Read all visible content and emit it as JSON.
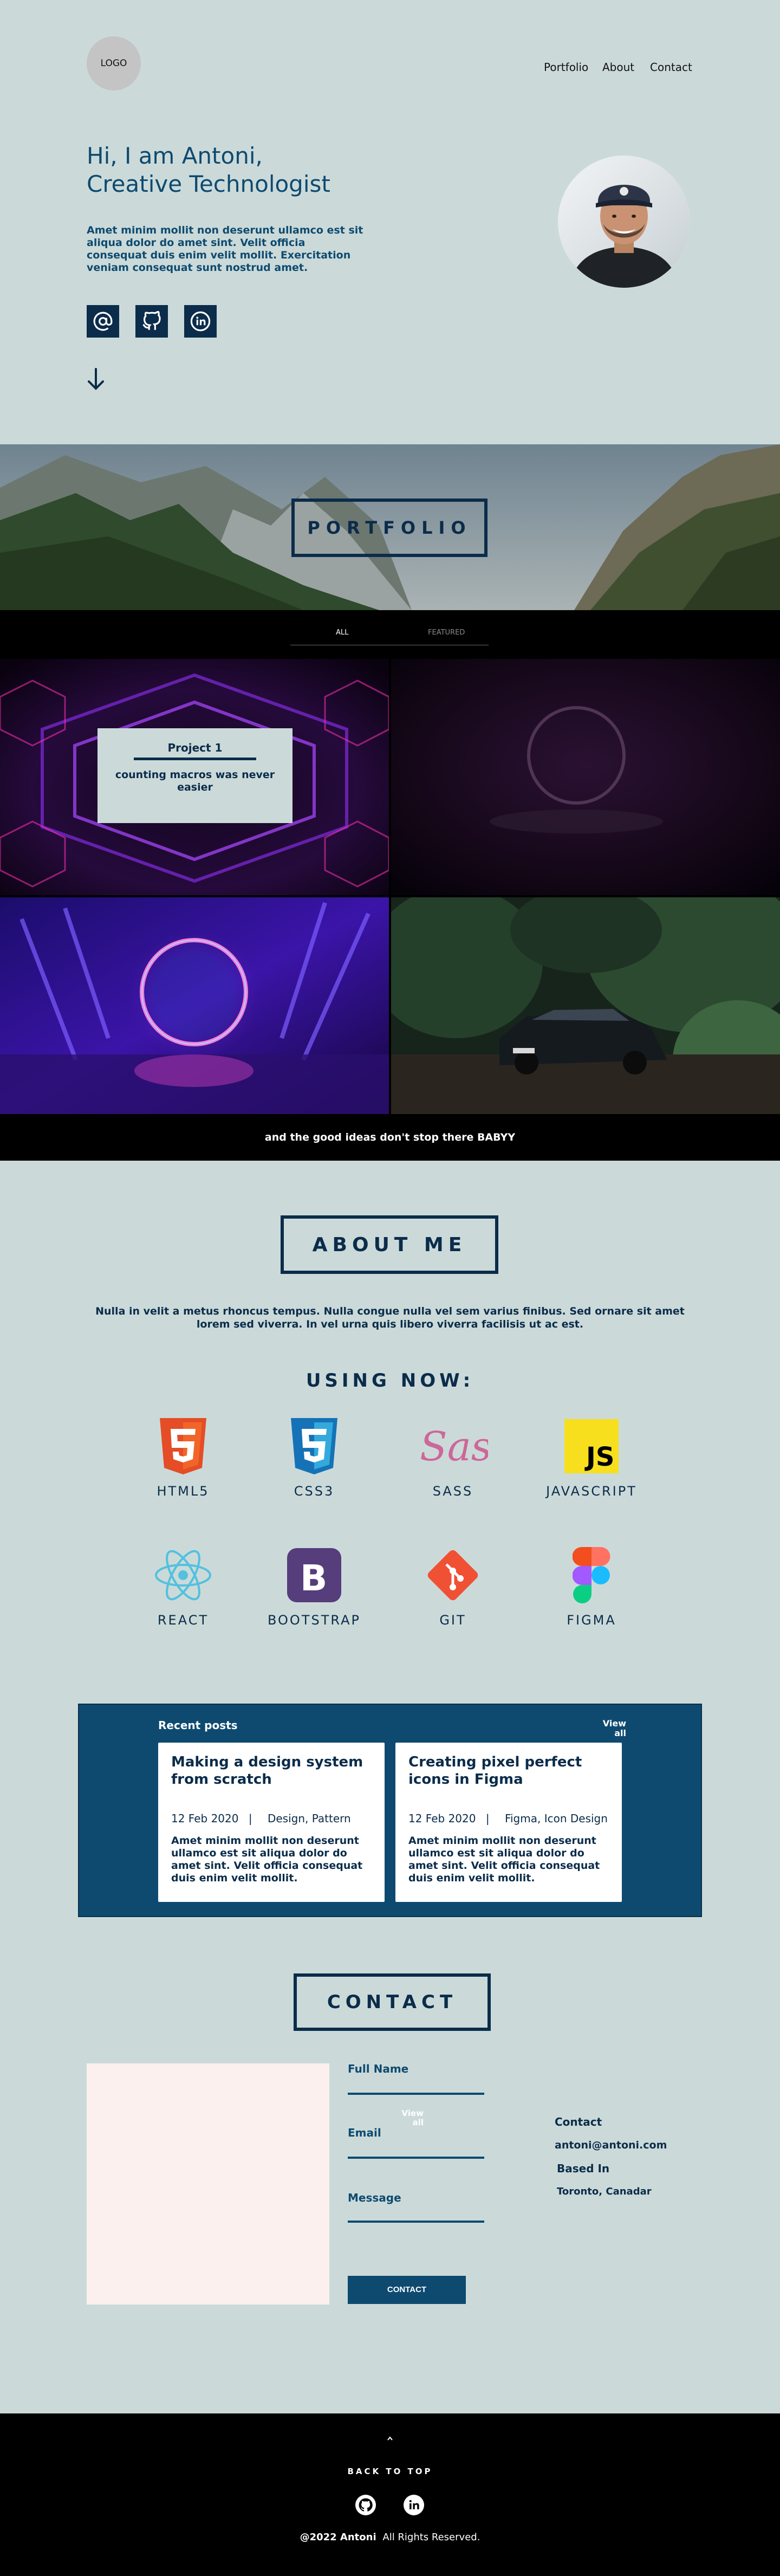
{
  "header": {
    "logo": "LOGO",
    "nav": [
      "Portfolio",
      "About",
      "Contact"
    ]
  },
  "hero": {
    "title_line1": "Hi, I am Antoni,",
    "title_line2": "Creative Technologist",
    "description": "Amet minim mollit non deserunt ullamco est sit aliqua dolor do amet sint. Velit officia consequat duis enim velit mollit. Exercitation veniam consequat sunt nostrud amet.",
    "socials": [
      "at-sign-icon",
      "github-icon",
      "linkedin-icon"
    ],
    "scroll_icon": "arrow-down-icon"
  },
  "portfolio": {
    "title": "PORTFOLIO",
    "tabs": [
      "ALL",
      "FEATURED"
    ],
    "project_card": {
      "title": "Project 1",
      "subtitle": "counting macros was never easier"
    },
    "footer_text": "and the good ideas don't stop there BABYY"
  },
  "about": {
    "title": "ABOUT ME",
    "text": "Nulla in velit a metus rhoncus tempus. Nulla congue nulla vel sem varius finibus. Sed ornare sit amet lorem sed viverra. In vel urna quis libero viverra facilisis ut ac est.",
    "using_now": "USING NOW:",
    "tools": [
      "HTML5",
      "CSS3",
      "SASS",
      "JAVASCRIPT",
      "REACT",
      "BOOTSTRAP",
      "GIT",
      "FIGMA"
    ]
  },
  "posts": {
    "heading": "Recent posts",
    "view_all": "View all",
    "items": [
      {
        "title": "Making a design system from scratch",
        "date": "12 Feb 2020",
        "tags": "Design, Pattern",
        "body": "Amet minim mollit non deserunt ullamco est sit aliqua dolor do amet sint. Velit officia consequat duis enim velit mollit."
      },
      {
        "title": "Creating pixel perfect icons in Figma",
        "date": "12 Feb 2020",
        "tags": "Figma, Icon Design",
        "body": "Amet minim mollit non deserunt ullamco est sit aliqua dolor do amet sint. Velit officia consequat duis enim velit mollit."
      }
    ]
  },
  "contact": {
    "title": "CONTACT",
    "full_name_label": "Full Name",
    "email_label": "Email",
    "message_label": "Message",
    "stray_view_all": "View all",
    "submit_label": "CONTACT",
    "info_heading": "Contact",
    "email": "antoni@antoni.com",
    "based_in_label": "Based In",
    "location": "Toronto, Canadar"
  },
  "footer": {
    "back_to_top": "BACK TO TOP",
    "copyright_bold": "@2022 Antoni",
    "copyright_rest": "All Rights Reserved."
  },
  "colors": {
    "background": "#cbdad9",
    "navy": "#0b2c4a",
    "accent_blue": "#0e4a70",
    "black": "#000000"
  }
}
